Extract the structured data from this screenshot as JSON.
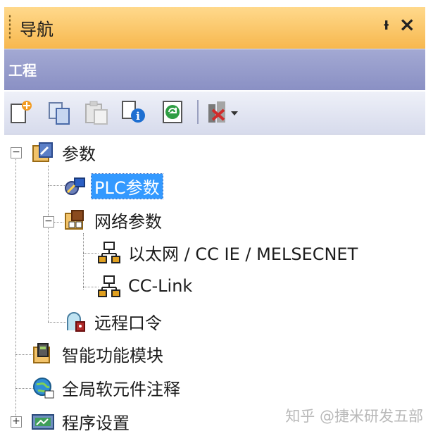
{
  "panel": {
    "title": "导航",
    "pin_icon": "pin-icon",
    "close_icon": "close-icon"
  },
  "section": {
    "label": "工程"
  },
  "toolbar": {
    "buttons": [
      "new-data-icon",
      "copy-icon",
      "paste-icon",
      "properties-icon",
      "refresh-icon",
      "filter-dropdown-icon"
    ]
  },
  "tree": {
    "params": "参数",
    "plc_params": "PLC参数",
    "network_params": "网络参数",
    "ethernet": "以太网 / CC IE / MELSECNET",
    "cclink": "CC-Link",
    "remote_password": "远程口令",
    "intelligent_module": "智能功能模块",
    "global_comment": "全局软元件注释",
    "program_settings": "程序设置"
  },
  "watermark": "知乎 @捷米研发五部"
}
